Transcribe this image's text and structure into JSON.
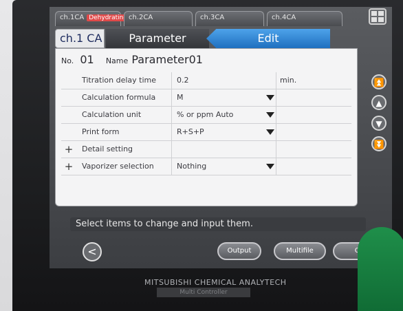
{
  "tabs": [
    {
      "label": "ch.1CA",
      "badge": "Dehydrating"
    },
    {
      "label": "ch.2CA"
    },
    {
      "label": "ch.3CA"
    },
    {
      "label": "ch.4CA"
    }
  ],
  "header": {
    "channel": "ch.1 CA",
    "section": "Parameter",
    "mode": "Edit"
  },
  "parameter": {
    "no_label": "No.",
    "no_value": "01",
    "name_label": "Name",
    "name_value": "Parameter01"
  },
  "rows": [
    {
      "label": "Titration delay time",
      "value": "0.2",
      "unit": "min.",
      "dropdown": false,
      "plus": false
    },
    {
      "label": "Calculation formula",
      "value": "M",
      "unit": "",
      "dropdown": true,
      "plus": false
    },
    {
      "label": "Calculation unit",
      "value": "% or ppm Auto",
      "unit": "",
      "dropdown": true,
      "plus": false
    },
    {
      "label": "Print form",
      "value": "R+S+P",
      "unit": "",
      "dropdown": true,
      "plus": false
    },
    {
      "label": "Detail setting",
      "value": "",
      "unit": "",
      "dropdown": false,
      "plus": true
    },
    {
      "label": "Vaporizer selection",
      "value": "Nothing",
      "unit": "",
      "dropdown": true,
      "plus": true
    }
  ],
  "status_text": "Select items to change and input them.",
  "buttons": {
    "back": "<",
    "output": "Output",
    "multifile": "Multifile",
    "ok": "OK"
  },
  "brand": {
    "maker": "MITSUBISHI CHEMICAL ANALYTECH",
    "product": "Multi Controller"
  }
}
